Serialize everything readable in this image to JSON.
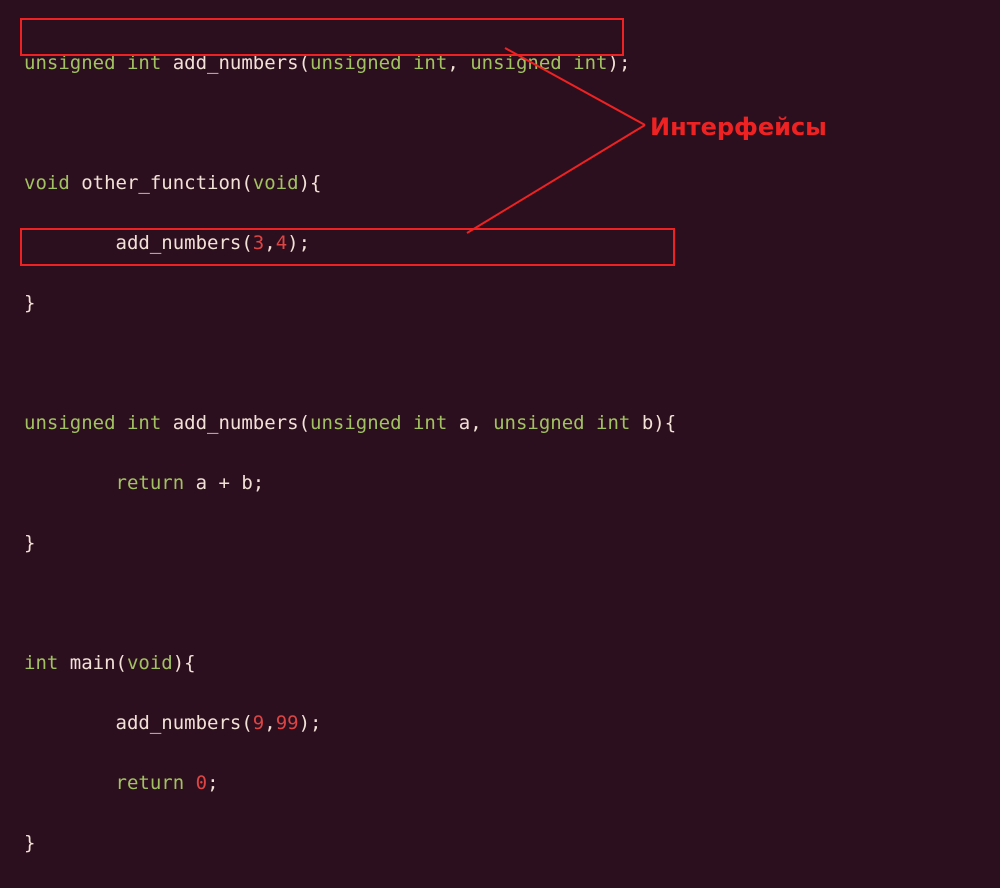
{
  "annotation": {
    "label": "Интерфейсы"
  },
  "code": {
    "line1": {
      "t1": "unsigned",
      "t2": " ",
      "t3": "int",
      "t4": " add_numbers(",
      "t5": "unsigned",
      "t6": " ",
      "t7": "int",
      "t8": ", ",
      "t9": "unsigned",
      "t10": " ",
      "t11": "int",
      "t12": ");"
    },
    "line3": {
      "t1": "void",
      "t2": " other_function(",
      "t3": "void",
      "t4": "){"
    },
    "line4": {
      "t1": "        add_numbers(",
      "t2": "3",
      "t3": ",",
      "t4": "4",
      "t5": ");"
    },
    "line5": {
      "t1": "}"
    },
    "line7": {
      "t1": "unsigned",
      "t2": " ",
      "t3": "int",
      "t4": " add_numbers(",
      "t5": "unsigned",
      "t6": " ",
      "t7": "int",
      "t8": " a, ",
      "t9": "unsigned",
      "t10": " ",
      "t11": "int",
      "t12": " b){"
    },
    "line8": {
      "t1": "        ",
      "t2": "return",
      "t3": " a + b;"
    },
    "line9": {
      "t1": "}"
    },
    "line11": {
      "t1": "int",
      "t2": " main(",
      "t3": "void",
      "t4": "){"
    },
    "line12": {
      "t1": "        add_numbers(",
      "t2": "9",
      "t3": ",",
      "t4": "99",
      "t5": ");"
    },
    "line13": {
      "t1": "        ",
      "t2": "return",
      "t3": " ",
      "t4": "0",
      "t5": ";"
    },
    "line14": {
      "t1": "}"
    }
  }
}
